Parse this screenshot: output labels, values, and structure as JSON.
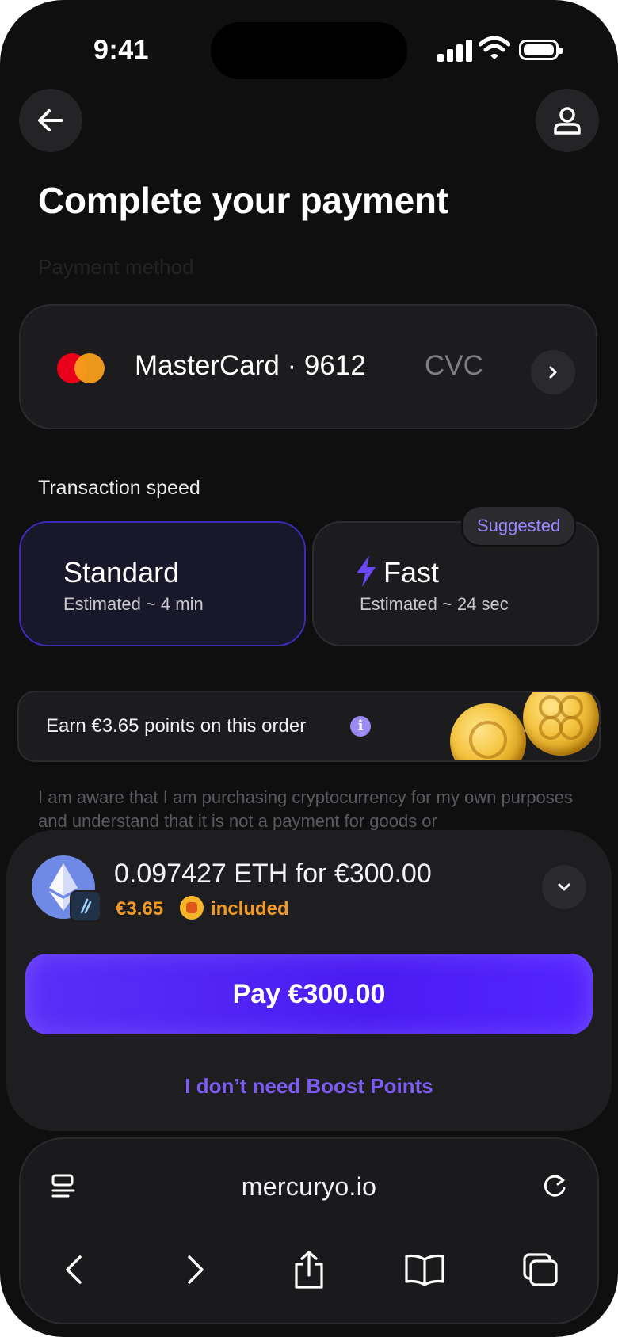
{
  "status_bar": {
    "time": "9:41"
  },
  "header": {
    "title": "Complete your payment",
    "section_label": "Payment method"
  },
  "payment_card": {
    "name": "MasterCard · 9612",
    "cvc_placeholder": "CVC"
  },
  "transaction_speed": {
    "label": "Transaction speed",
    "options": [
      {
        "name": "Standard",
        "estimate": "Estimated ~ 4 min",
        "selected": true
      },
      {
        "name": "Fast",
        "estimate": "Estimated ~ 24 sec",
        "badge": "Suggested",
        "selected": false
      }
    ]
  },
  "points": {
    "text": "Earn €3.65 points on this order",
    "info_icon": "i"
  },
  "disclaimer": "I am aware that I am purchasing cryptocurrency for my own purposes and understand that it is not a payment for goods or",
  "order": {
    "summary": "0.097427 ETH for €300.00",
    "fee": "€3.65",
    "fee_suffix": "included"
  },
  "pay_button": {
    "label": "Pay €300.00"
  },
  "opt_out": {
    "label": "I don’t need Boost Points"
  },
  "browser": {
    "url": "mercuryo.io"
  },
  "colors": {
    "background": "#0f0f10",
    "accent": "#5a2ff8",
    "accent_text": "#7c5cf4",
    "fee": "#f09a26"
  }
}
